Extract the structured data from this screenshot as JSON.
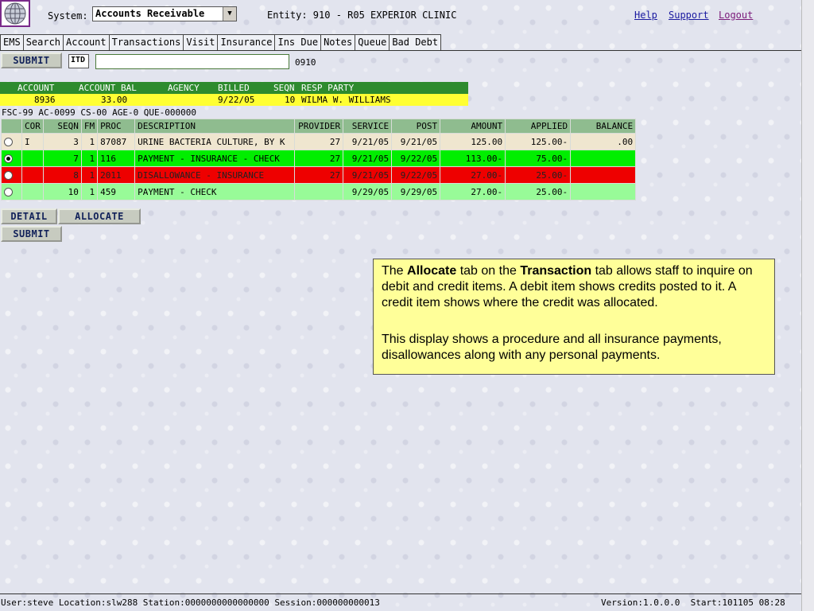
{
  "header": {
    "system_label": "System:",
    "system_value": "Accounts Receivable",
    "entity": "Entity: 910 - R05 EXPERIOR CLINIC",
    "links": {
      "help": "Help",
      "support": "Support",
      "logout": "Logout"
    }
  },
  "tabs": [
    "EMS",
    "Search",
    "Account",
    "Transactions",
    "Visit",
    "Insurance",
    "Ins Due",
    "Notes",
    "Queue",
    "Bad Debt"
  ],
  "command": {
    "submit": "SUBMIT",
    "mode": "ITD",
    "input_value": "",
    "code": "0910"
  },
  "account_header": {
    "labels": {
      "account": "ACCOUNT",
      "account_bal": "ACCOUNT BAL",
      "agency": "AGENCY",
      "billed": "BILLED",
      "seqn": "SEQN",
      "resp_party": "RESP PARTY"
    },
    "values": {
      "account": "8936",
      "account_bal": "33.00",
      "agency": "",
      "billed": "9/22/05",
      "seqn": "10",
      "resp_party": "WILMA W. WILLIAMS"
    }
  },
  "codes_line": "FSC-99 AC-0099 CS-00 AGE-0 QUE-000000",
  "table": {
    "columns": [
      "",
      "COR",
      "SEQN",
      "FM",
      "PROC",
      "DESCRIPTION",
      "PROVIDER",
      "SERVICE",
      "POST",
      "AMOUNT",
      "APPLIED",
      "BALANCE"
    ],
    "rows": [
      {
        "selected": false,
        "cor": "I",
        "seqn": "3",
        "fm": "1",
        "proc": "87087",
        "description": "URINE BACTERIA CULTURE, BY K",
        "provider": "27",
        "service": "9/21/05",
        "post": "9/21/05",
        "amount": "125.00",
        "applied": "125.00-",
        "balance": ".00"
      },
      {
        "selected": true,
        "cor": "",
        "seqn": "7",
        "fm": "1",
        "proc": "116",
        "description": "PAYMENT - INSURANCE - CHECK",
        "provider": "27",
        "service": "9/21/05",
        "post": "9/22/05",
        "amount": "113.00-",
        "applied": "75.00-",
        "balance": ""
      },
      {
        "selected": false,
        "cor": "",
        "seqn": "8",
        "fm": "1",
        "proc": "2011",
        "description": "DISALLOWANCE - INSURANCE",
        "provider": "27",
        "service": "9/21/05",
        "post": "9/22/05",
        "amount": "27.00-",
        "applied": "25.00-",
        "balance": ""
      },
      {
        "selected": false,
        "cor": "",
        "seqn": "10",
        "fm": "1",
        "proc": "459",
        "description": "PAYMENT - CHECK",
        "provider": "",
        "service": "9/29/05",
        "post": "9/29/05",
        "amount": "27.00-",
        "applied": "25.00-",
        "balance": ""
      }
    ]
  },
  "buttons": {
    "detail": "DETAIL",
    "allocate": "ALLOCATE",
    "submit2": "SUBMIT"
  },
  "note": {
    "p1_a": "The ",
    "p1_b": "Allocate",
    "p1_c": " tab on the ",
    "p1_d": "Transaction",
    "p1_e": " tab allows staff to inquire on debit and credit items.  A debit item shows credits posted to it.  A credit item shows where the credit was allocated.",
    "p2": "This display shows a procedure and all insurance payments, disallowances along with any personal payments."
  },
  "status": {
    "left": "User:steve Location:slw288 Station:0000000000000000 Session:000000000013",
    "right": "Version:1.0.0.0  Start:101105 08:28"
  }
}
